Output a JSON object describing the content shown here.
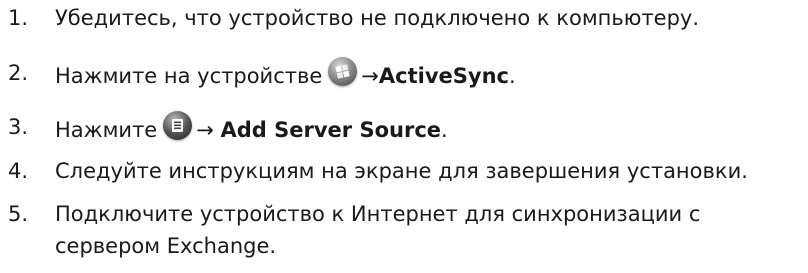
{
  "steps": [
    {
      "number": "1.",
      "text": "Убедитесь, что устройство не подключено к компьютеру."
    },
    {
      "number": "2.",
      "before": "Нажмите на устройстве",
      "icon": "windows-start-icon",
      "arrow": "→",
      "bold": "ActiveSync",
      "after": "."
    },
    {
      "number": "3.",
      "before": "Нажмите",
      "icon": "menu-icon",
      "arrow": "→ ",
      "bold": "Add Server Source",
      "after": "."
    },
    {
      "number": "4.",
      "text": "Следуйте инструкциям на экране для завершения установки."
    },
    {
      "number": "5.",
      "line1": "Подключите устройство к Интернет для синхронизации с",
      "line2": "сервером Exchange."
    }
  ]
}
